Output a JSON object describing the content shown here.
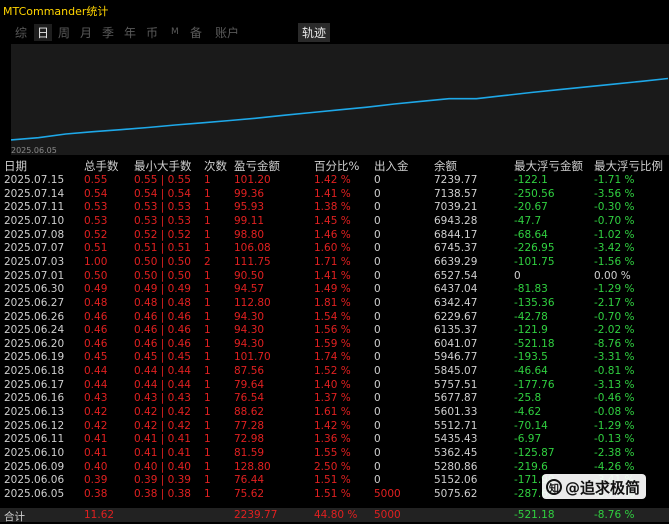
{
  "app": {
    "title": "MTCommander统计"
  },
  "tabs": [
    "综",
    "日",
    "周",
    "月",
    "季",
    "年",
    "币",
    "M",
    "备",
    "账户"
  ],
  "active_tab": "日",
  "track_label": "轨迹",
  "chart": {
    "start_label": "2025.06.05",
    "line_color": "#1ea8e8"
  },
  "chart_data": {
    "type": "line",
    "x": [
      "2025.06.05",
      "2025.06.06",
      "2025.06.09",
      "2025.06.10",
      "2025.06.11",
      "2025.06.12",
      "2025.06.13",
      "2025.06.16",
      "2025.06.17",
      "2025.06.18",
      "2025.06.19",
      "2025.06.20",
      "2025.06.23",
      "2025.06.24",
      "2025.06.26",
      "2025.06.27",
      "2025.06.30",
      "2025.07.01",
      "2025.07.03",
      "2025.07.07",
      "2025.07.08",
      "2025.07.10",
      "2025.07.11",
      "2025.07.14",
      "2025.07.15"
    ],
    "y": [
      5075.62,
      5152.06,
      5280.86,
      5362.45,
      5435.43,
      5512.71,
      5601.33,
      5677.87,
      5757.51,
      5845.07,
      5946.77,
      6041.07,
      6135.37,
      6229.67,
      6342.47,
      6437.04,
      6527.54,
      6527.54,
      6639.29,
      6745.37,
      6844.17,
      6943.28,
      7039.21,
      7138.57,
      7239.77
    ]
  },
  "headers": {
    "date": "日期",
    "lots": "总手数",
    "minmax": "最小大手数",
    "count": "次数",
    "pl": "盈亏金额",
    "pct": "百分比%",
    "io": "出入金",
    "balance": "余额",
    "max_float": "最大浮亏金额",
    "max_float_pct": "最大浮亏比例"
  },
  "rows": [
    {
      "date": "2025.07.15",
      "lots": "0.55",
      "minmax": "0.55 | 0.55",
      "count": "1",
      "pl": "101.20",
      "pct": "1.42 %",
      "io": "0",
      "balance": "7239.77",
      "flt": "-122.1",
      "fltp": "-1.71 %"
    },
    {
      "date": "2025.07.14",
      "lots": "0.54",
      "minmax": "0.54 | 0.54",
      "count": "1",
      "pl": "99.36",
      "pct": "1.41 %",
      "io": "0",
      "balance": "7138.57",
      "flt": "-250.56",
      "fltp": "-3.56 %"
    },
    {
      "date": "2025.07.11",
      "lots": "0.53",
      "minmax": "0.53 | 0.53",
      "count": "1",
      "pl": "95.93",
      "pct": "1.38 %",
      "io": "0",
      "balance": "7039.21",
      "flt": "-20.67",
      "fltp": "-0.30 %"
    },
    {
      "date": "2025.07.10",
      "lots": "0.53",
      "minmax": "0.53 | 0.53",
      "count": "1",
      "pl": "99.11",
      "pct": "1.45 %",
      "io": "0",
      "balance": "6943.28",
      "flt": "-47.7",
      "fltp": "-0.70 %"
    },
    {
      "date": "2025.07.08",
      "lots": "0.52",
      "minmax": "0.52 | 0.52",
      "count": "1",
      "pl": "98.80",
      "pct": "1.46 %",
      "io": "0",
      "balance": "6844.17",
      "flt": "-68.64",
      "fltp": "-1.02 %"
    },
    {
      "date": "2025.07.07",
      "lots": "0.51",
      "minmax": "0.51 | 0.51",
      "count": "1",
      "pl": "106.08",
      "pct": "1.60 %",
      "io": "0",
      "balance": "6745.37",
      "flt": "-226.95",
      "fltp": "-3.42 %"
    },
    {
      "date": "2025.07.03",
      "lots": "1.00",
      "minmax": "0.50 | 0.50",
      "count": "2",
      "pl": "111.75",
      "pct": "1.71 %",
      "io": "0",
      "balance": "6639.29",
      "flt": "-101.75",
      "fltp": "-1.56 %"
    },
    {
      "date": "2025.07.01",
      "lots": "0.50",
      "minmax": "0.50 | 0.50",
      "count": "1",
      "pl": "90.50",
      "pct": "1.41 %",
      "io": "0",
      "balance": "6527.54",
      "flt": "0",
      "fltp": "0.00 %"
    },
    {
      "date": "2025.06.30",
      "lots": "0.49",
      "minmax": "0.49 | 0.49",
      "count": "1",
      "pl": "94.57",
      "pct": "1.49 %",
      "io": "0",
      "balance": "6437.04",
      "flt": "-81.83",
      "fltp": "-1.29 %"
    },
    {
      "date": "2025.06.27",
      "lots": "0.48",
      "minmax": "0.48 | 0.48",
      "count": "1",
      "pl": "112.80",
      "pct": "1.81 %",
      "io": "0",
      "balance": "6342.47",
      "flt": "-135.36",
      "fltp": "-2.17 %"
    },
    {
      "date": "2025.06.26",
      "lots": "0.46",
      "minmax": "0.46 | 0.46",
      "count": "1",
      "pl": "94.30",
      "pct": "1.54 %",
      "io": "0",
      "balance": "6229.67",
      "flt": "-42.78",
      "fltp": "-0.70 %"
    },
    {
      "date": "2025.06.24",
      "lots": "0.46",
      "minmax": "0.46 | 0.46",
      "count": "1",
      "pl": "94.30",
      "pct": "1.56 %",
      "io": "0",
      "balance": "6135.37",
      "flt": "-121.9",
      "fltp": "-2.02 %"
    },
    {
      "date": "2025.06.20",
      "lots": "0.46",
      "minmax": "0.46 | 0.46",
      "count": "1",
      "pl": "94.30",
      "pct": "1.59 %",
      "io": "0",
      "balance": "6041.07",
      "flt": "-521.18",
      "fltp": "-8.76 %"
    },
    {
      "date": "2025.06.19",
      "lots": "0.45",
      "minmax": "0.45 | 0.45",
      "count": "1",
      "pl": "101.70",
      "pct": "1.74 %",
      "io": "0",
      "balance": "5946.77",
      "flt": "-193.5",
      "fltp": "-3.31 %"
    },
    {
      "date": "2025.06.18",
      "lots": "0.44",
      "minmax": "0.44 | 0.44",
      "count": "1",
      "pl": "87.56",
      "pct": "1.52 %",
      "io": "0",
      "balance": "5845.07",
      "flt": "-46.64",
      "fltp": "-0.81 %"
    },
    {
      "date": "2025.06.17",
      "lots": "0.44",
      "minmax": "0.44 | 0.44",
      "count": "1",
      "pl": "79.64",
      "pct": "1.40 %",
      "io": "0",
      "balance": "5757.51",
      "flt": "-177.76",
      "fltp": "-3.13 %"
    },
    {
      "date": "2025.06.16",
      "lots": "0.43",
      "minmax": "0.43 | 0.43",
      "count": "1",
      "pl": "76.54",
      "pct": "1.37 %",
      "io": "0",
      "balance": "5677.87",
      "flt": "-25.8",
      "fltp": "-0.46 %"
    },
    {
      "date": "2025.06.13",
      "lots": "0.42",
      "minmax": "0.42 | 0.42",
      "count": "1",
      "pl": "88.62",
      "pct": "1.61 %",
      "io": "0",
      "balance": "5601.33",
      "flt": "-4.62",
      "fltp": "-0.08 %"
    },
    {
      "date": "2025.06.12",
      "lots": "0.42",
      "minmax": "0.42 | 0.42",
      "count": "1",
      "pl": "77.28",
      "pct": "1.42 %",
      "io": "0",
      "balance": "5512.71",
      "flt": "-70.14",
      "fltp": "-1.29 %"
    },
    {
      "date": "2025.06.11",
      "lots": "0.41",
      "minmax": "0.41 | 0.41",
      "count": "1",
      "pl": "72.98",
      "pct": "1.36 %",
      "io": "0",
      "balance": "5435.43",
      "flt": "-6.97",
      "fltp": "-0.13 %"
    },
    {
      "date": "2025.06.10",
      "lots": "0.41",
      "minmax": "0.41 | 0.41",
      "count": "1",
      "pl": "81.59",
      "pct": "1.55 %",
      "io": "0",
      "balance": "5362.45",
      "flt": "-125.87",
      "fltp": "-2.38 %"
    },
    {
      "date": "2025.06.09",
      "lots": "0.40",
      "minmax": "0.40 | 0.40",
      "count": "1",
      "pl": "128.80",
      "pct": "2.50 %",
      "io": "0",
      "balance": "5280.86",
      "flt": "-219.6",
      "fltp": "-4.26 %"
    },
    {
      "date": "2025.06.06",
      "lots": "0.39",
      "minmax": "0.39 | 0.39",
      "count": "1",
      "pl": "76.44",
      "pct": "1.51 %",
      "io": "0",
      "balance": "5152.06",
      "flt": "-171.99",
      "fltp": "-3.41 %"
    },
    {
      "date": "2025.06.05",
      "lots": "0.38",
      "minmax": "0.38 | 0.38",
      "count": "1",
      "pl": "75.62",
      "pct": "1.51 %",
      "io": "5000",
      "balance": "5075.62",
      "flt": "-287.66",
      "fltp": "-5.75 %"
    }
  ],
  "total": {
    "label": "合计",
    "lots": "11.62",
    "pl": "2239.77",
    "pct": "44.80 %",
    "io": "5000",
    "flt": "-521.18",
    "fltp": "-8.76 %"
  },
  "watermark": {
    "logo": "知",
    "text": "@追求极简"
  }
}
